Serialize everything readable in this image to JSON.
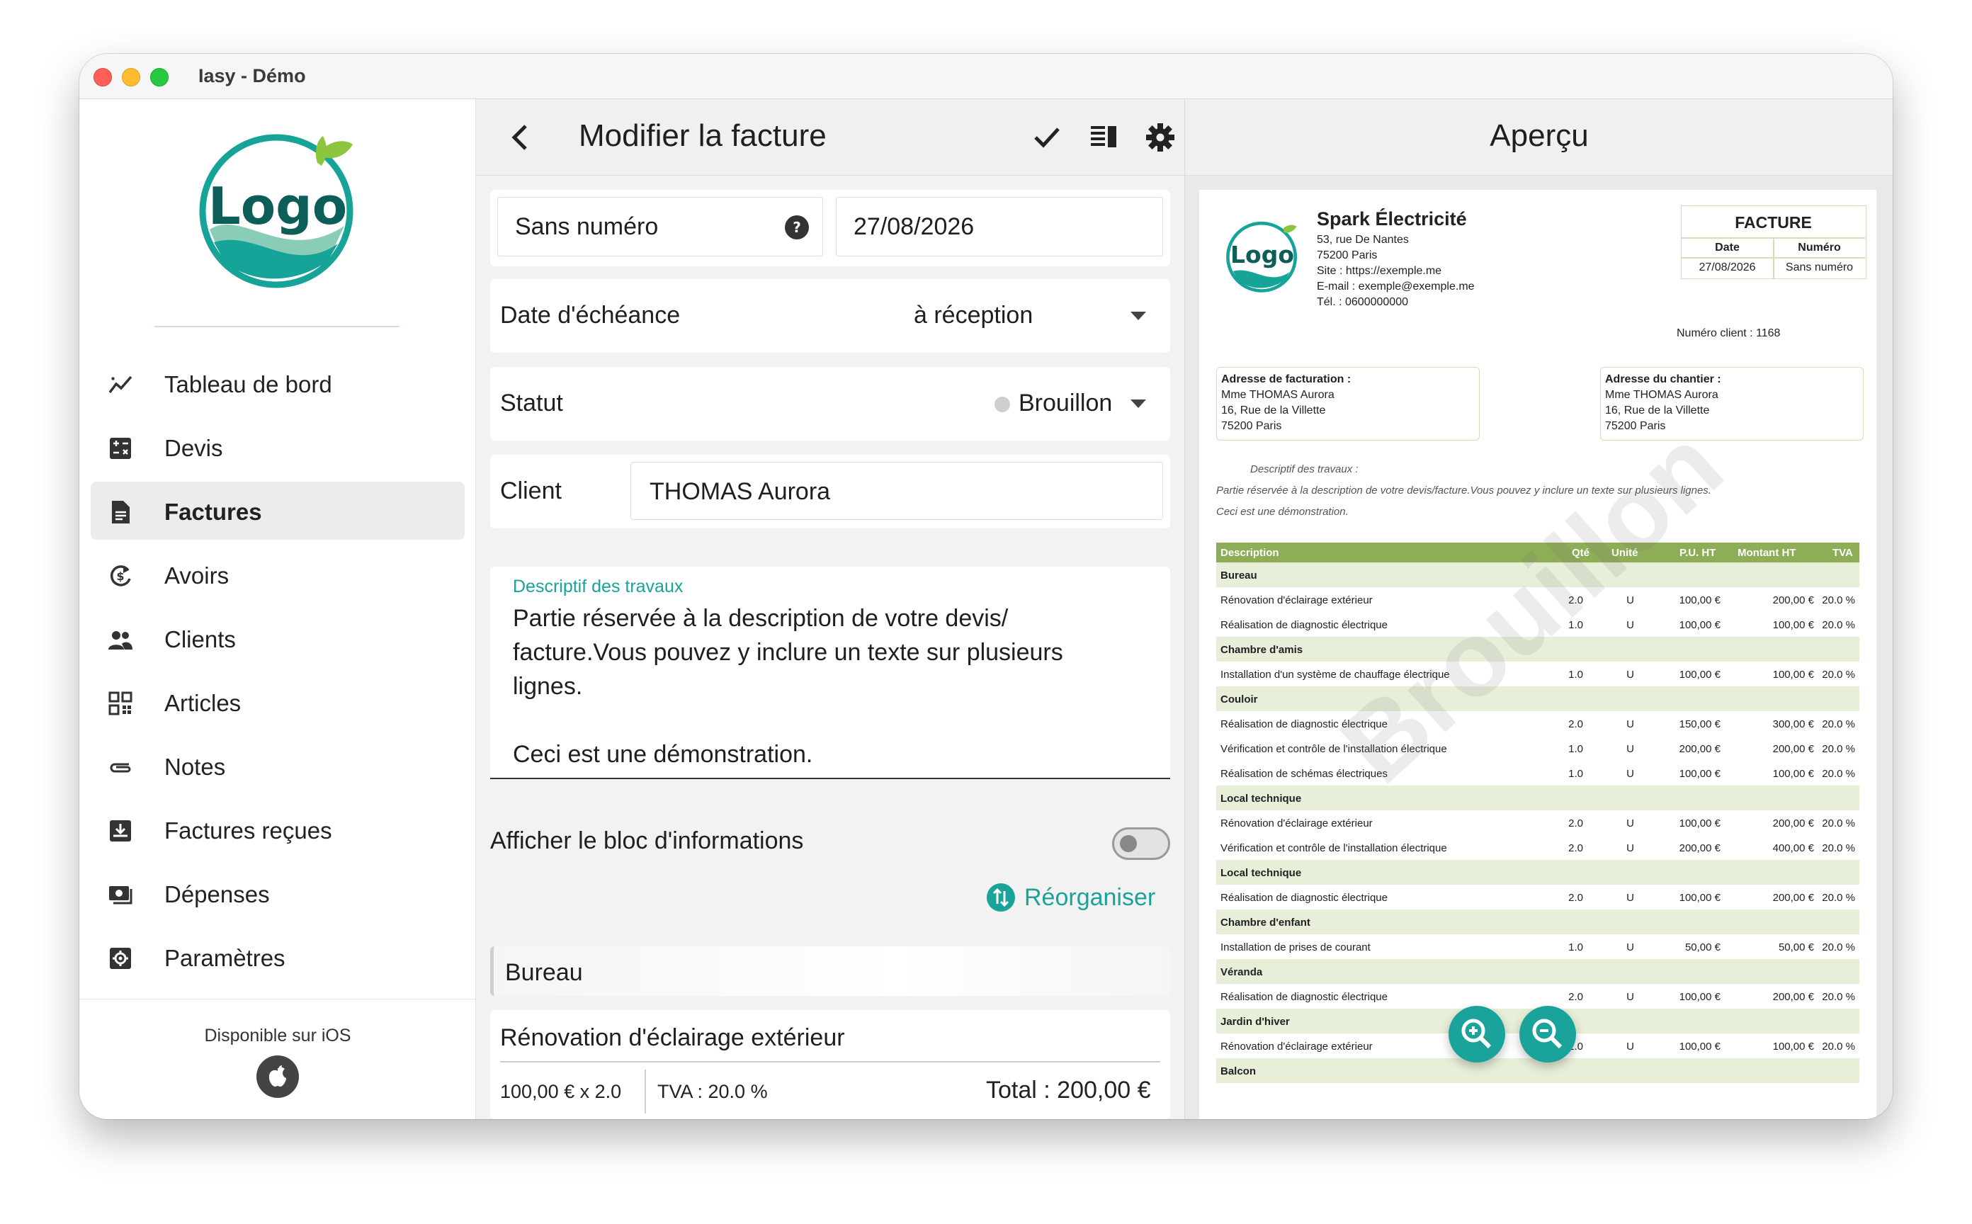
{
  "window": {
    "title": "Iasy - Démo"
  },
  "sidebar": {
    "logo_text": "Logo",
    "items": [
      {
        "label": "Tableau de bord",
        "icon": "chart-line-icon",
        "active": false
      },
      {
        "label": "Devis",
        "icon": "calculator-icon",
        "active": false
      },
      {
        "label": "Factures",
        "icon": "document-icon",
        "active": true
      },
      {
        "label": "Avoirs",
        "icon": "refund-icon",
        "active": false
      },
      {
        "label": "Clients",
        "icon": "people-icon",
        "active": false
      },
      {
        "label": "Articles",
        "icon": "qr-code-icon",
        "active": false
      },
      {
        "label": "Notes",
        "icon": "paperclip-icon",
        "active": false
      },
      {
        "label": "Factures reçues",
        "icon": "inbox-download-icon",
        "active": false
      },
      {
        "label": "Dépenses",
        "icon": "money-icon",
        "active": false
      },
      {
        "label": "Paramètres",
        "icon": "gear-box-icon",
        "active": false
      }
    ],
    "footer": {
      "label": "Disponible sur iOS"
    }
  },
  "editor": {
    "title": "Modifier la facture",
    "number_value": "Sans numéro",
    "date_value": "27/08/2026",
    "due_label": "Date d'échéance",
    "due_value": "à réception",
    "status_label": "Statut",
    "status_value": "Brouillon",
    "client_label": "Client",
    "client_value": "THOMAS Aurora",
    "desc_label": "Descriptif des travaux",
    "desc_line1": "Partie réservée à la description de votre devis/",
    "desc_line2": "facture.Vous pouvez y inclure un texte sur plusieurs",
    "desc_line3": "lignes.",
    "desc_line4": "Ceci est une démonstration.",
    "info_toggle_label": "Afficher le bloc d'informations",
    "info_toggle_on": false,
    "reorganize_label": "Réorganiser",
    "section_title": "Bureau",
    "line_item": {
      "title": "Rénovation d'éclairage extérieur",
      "price_qty": "100,00 €  x 2.0",
      "tva": "TVA : 20.0 %",
      "total": "Total : 200,00 €"
    }
  },
  "preview": {
    "title": "Aperçu",
    "company": {
      "name": "Spark Électricité",
      "logo_text": "Logo",
      "address1": "53, rue De Nantes",
      "address2": "75200 Paris",
      "site": "Site : https://exemple.me",
      "email": "E-mail : exemple@exemple.me",
      "phone": "Tél. : 0600000000"
    },
    "doc": {
      "type": "FACTURE",
      "date_label": "Date",
      "number_label": "Numéro",
      "date": "27/08/2026",
      "number": "Sans numéro"
    },
    "client_number": "Numéro client : 1168",
    "billing": {
      "title": "Adresse de facturation :",
      "line1": "Mme THOMAS Aurora",
      "line2": "16, Rue de la Villette",
      "line3": "75200 Paris"
    },
    "site_addr": {
      "title": "Adresse du chantier :",
      "line1": "Mme THOMAS Aurora",
      "line2": "16, Rue de la Villette",
      "line3": "75200 Paris"
    },
    "desc_title": "Descriptif des travaux :",
    "desc_line1": "Partie réservée à la description de votre devis/facture.Vous pouvez y inclure un texte sur plusieurs lignes.",
    "desc_line2": "Ceci est une démonstration.",
    "watermark": "Brouillon",
    "table": {
      "headers": {
        "desc": "Description",
        "qty": "Qté",
        "unit": "Unité",
        "pu": "P.U. HT",
        "amount": "Montant HT",
        "tva": "TVA"
      },
      "rows": [
        {
          "group": "Bureau"
        },
        {
          "desc": "Rénovation d'éclairage extérieur",
          "qty": "2.0",
          "unit": "U",
          "pu": "100,00 €",
          "amount": "200,00 €",
          "tva": "20.0 %"
        },
        {
          "desc": "Réalisation de diagnostic électrique",
          "qty": "1.0",
          "unit": "U",
          "pu": "100,00 €",
          "amount": "100,00 €",
          "tva": "20.0 %"
        },
        {
          "group": "Chambre d'amis"
        },
        {
          "desc": "Installation d'un système de chauffage électrique",
          "qty": "1.0",
          "unit": "U",
          "pu": "100,00 €",
          "amount": "100,00 €",
          "tva": "20.0 %"
        },
        {
          "group": "Couloir"
        },
        {
          "desc": "Réalisation de diagnostic électrique",
          "qty": "2.0",
          "unit": "U",
          "pu": "150,00 €",
          "amount": "300,00 €",
          "tva": "20.0 %"
        },
        {
          "desc": "Vérification et contrôle de l'installation électrique",
          "qty": "1.0",
          "unit": "U",
          "pu": "200,00 €",
          "amount": "200,00 €",
          "tva": "20.0 %"
        },
        {
          "desc": "Réalisation de schémas électriques",
          "qty": "1.0",
          "unit": "U",
          "pu": "100,00 €",
          "amount": "100,00 €",
          "tva": "20.0 %"
        },
        {
          "group": "Local technique"
        },
        {
          "desc": "Rénovation d'éclairage extérieur",
          "qty": "2.0",
          "unit": "U",
          "pu": "100,00 €",
          "amount": "200,00 €",
          "tva": "20.0 %"
        },
        {
          "desc": "Vérification et contrôle de l'installation électrique",
          "qty": "2.0",
          "unit": "U",
          "pu": "200,00 €",
          "amount": "400,00 €",
          "tva": "20.0 %"
        },
        {
          "group": "Local technique"
        },
        {
          "desc": "Réalisation de diagnostic électrique",
          "qty": "2.0",
          "unit": "U",
          "pu": "100,00 €",
          "amount": "200,00 €",
          "tva": "20.0 %"
        },
        {
          "group": "Chambre d'enfant"
        },
        {
          "desc": "Installation de prises de courant",
          "qty": "1.0",
          "unit": "U",
          "pu": "50,00 €",
          "amount": "50,00 €",
          "tva": "20.0 %"
        },
        {
          "group": "Véranda"
        },
        {
          "desc": "Réalisation de diagnostic électrique",
          "qty": "2.0",
          "unit": "U",
          "pu": "100,00 €",
          "amount": "200,00 €",
          "tva": "20.0 %"
        },
        {
          "group": "Jardin d'hiver"
        },
        {
          "desc": "Rénovation d'éclairage extérieur",
          "qty": "1.0",
          "unit": "U",
          "pu": "100,00 €",
          "amount": "100,00 €",
          "tva": "20.0 %"
        },
        {
          "group": "Balcon"
        }
      ]
    }
  },
  "colors": {
    "accent": "#1aa39a",
    "table_header": "#8dad57",
    "group_row": "#e7efd9"
  }
}
